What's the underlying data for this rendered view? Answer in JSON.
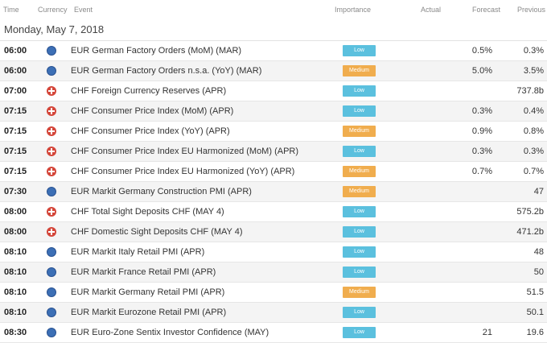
{
  "columns": {
    "time": "Time",
    "currency": "Currency",
    "event": "Event",
    "importance": "Importance",
    "actual": "Actual",
    "forecast": "Forecast",
    "previous": "Previous"
  },
  "date": "Monday, May 7, 2018",
  "colors": {
    "low": "#5bc0de",
    "medium": "#f0ad4e",
    "eur_flag": "#3c6fb5",
    "chf_flag": "#d4463a"
  },
  "rows": [
    {
      "time": "06:00",
      "currency": "EUR",
      "event": "EUR German Factory Orders (MoM) (MAR)",
      "importance": "Low",
      "actual": "",
      "forecast": "0.5%",
      "previous": "0.3%"
    },
    {
      "time": "06:00",
      "currency": "EUR",
      "event": "EUR German Factory Orders n.s.a. (YoY) (MAR)",
      "importance": "Medium",
      "actual": "",
      "forecast": "5.0%",
      "previous": "3.5%"
    },
    {
      "time": "07:00",
      "currency": "CHF",
      "event": "CHF Foreign Currency Reserves (APR)",
      "importance": "Low",
      "actual": "",
      "forecast": "",
      "previous": "737.8b"
    },
    {
      "time": "07:15",
      "currency": "CHF",
      "event": "CHF Consumer Price Index (MoM) (APR)",
      "importance": "Low",
      "actual": "",
      "forecast": "0.3%",
      "previous": "0.4%"
    },
    {
      "time": "07:15",
      "currency": "CHF",
      "event": "CHF Consumer Price Index (YoY) (APR)",
      "importance": "Medium",
      "actual": "",
      "forecast": "0.9%",
      "previous": "0.8%"
    },
    {
      "time": "07:15",
      "currency": "CHF",
      "event": "CHF Consumer Price Index EU Harmonized (MoM) (APR)",
      "importance": "Low",
      "actual": "",
      "forecast": "0.3%",
      "previous": "0.3%"
    },
    {
      "time": "07:15",
      "currency": "CHF",
      "event": "CHF Consumer Price Index EU Harmonized (YoY) (APR)",
      "importance": "Medium",
      "actual": "",
      "forecast": "0.7%",
      "previous": "0.7%"
    },
    {
      "time": "07:30",
      "currency": "EUR",
      "event": "EUR Markit Germany Construction PMI (APR)",
      "importance": "Medium",
      "actual": "",
      "forecast": "",
      "previous": "47"
    },
    {
      "time": "08:00",
      "currency": "CHF",
      "event": "CHF Total Sight Deposits CHF (MAY 4)",
      "importance": "Low",
      "actual": "",
      "forecast": "",
      "previous": "575.2b"
    },
    {
      "time": "08:00",
      "currency": "CHF",
      "event": "CHF Domestic Sight Deposits CHF (MAY 4)",
      "importance": "Low",
      "actual": "",
      "forecast": "",
      "previous": "471.2b"
    },
    {
      "time": "08:10",
      "currency": "EUR",
      "event": "EUR Markit Italy Retail PMI (APR)",
      "importance": "Low",
      "actual": "",
      "forecast": "",
      "previous": "48"
    },
    {
      "time": "08:10",
      "currency": "EUR",
      "event": "EUR Markit France Retail PMI (APR)",
      "importance": "Low",
      "actual": "",
      "forecast": "",
      "previous": "50"
    },
    {
      "time": "08:10",
      "currency": "EUR",
      "event": "EUR Markit Germany Retail PMI (APR)",
      "importance": "Medium",
      "actual": "",
      "forecast": "",
      "previous": "51.5"
    },
    {
      "time": "08:10",
      "currency": "EUR",
      "event": "EUR Markit Eurozone Retail PMI (APR)",
      "importance": "Low",
      "actual": "",
      "forecast": "",
      "previous": "50.1"
    },
    {
      "time": "08:30",
      "currency": "EUR",
      "event": "EUR Euro-Zone Sentix Investor Confidence (MAY)",
      "importance": "Low",
      "actual": "",
      "forecast": "21",
      "previous": "19.6"
    }
  ]
}
